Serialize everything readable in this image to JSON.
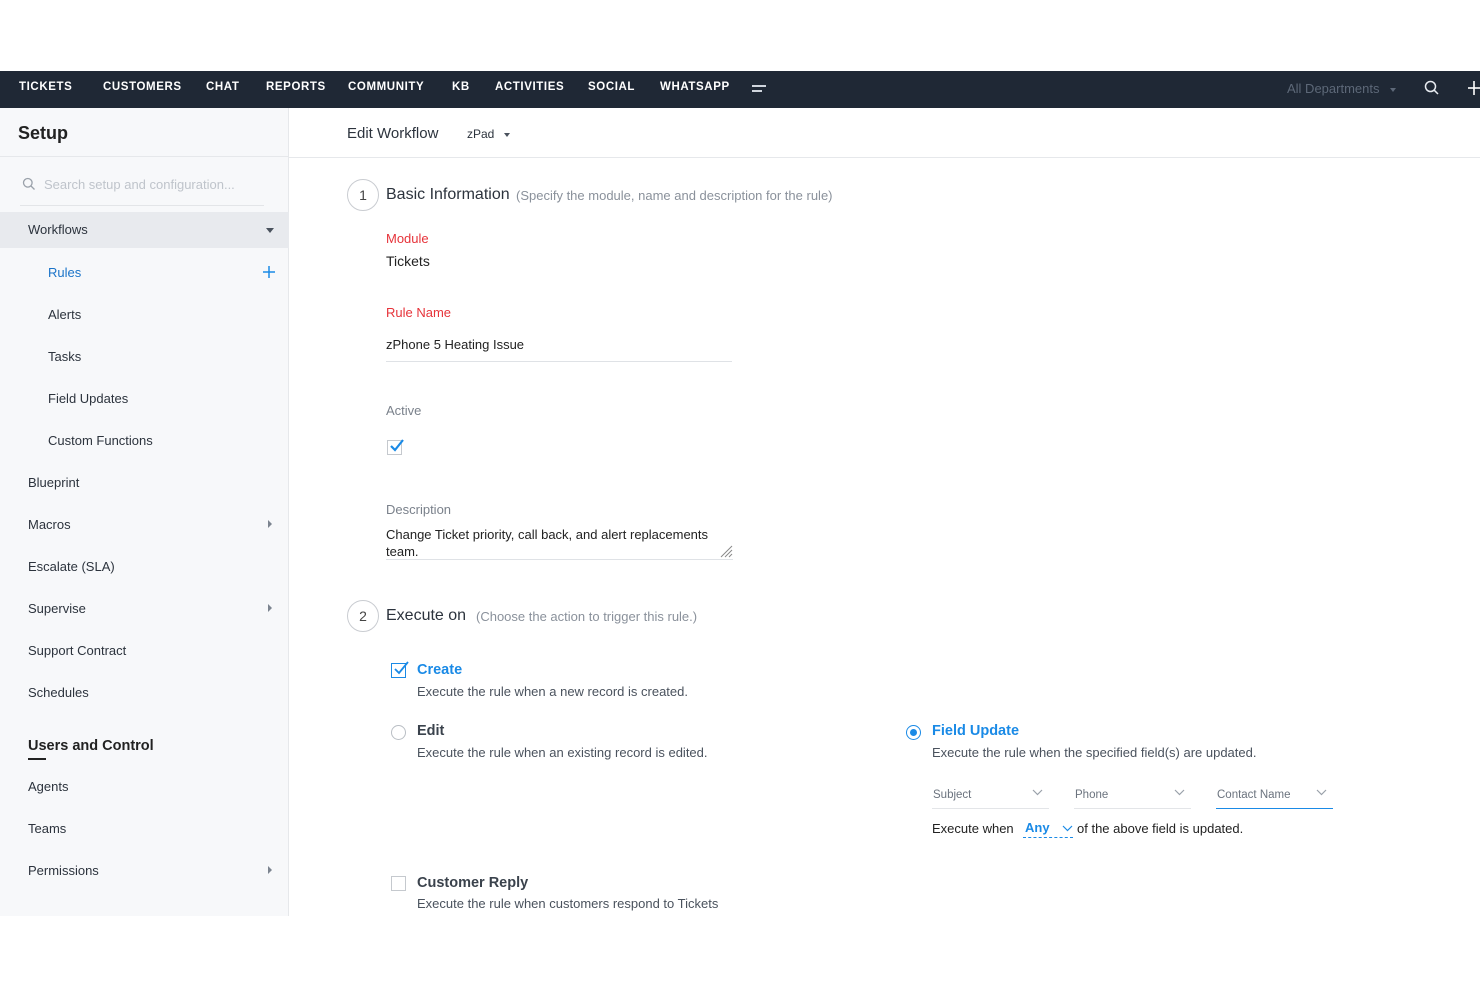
{
  "topnav": {
    "items": [
      "TICKETS",
      "CUSTOMERS",
      "CHAT",
      "REPORTS",
      "COMMUNITY",
      "KB",
      "ACTIVITIES",
      "SOCIAL",
      "WHATSAPP"
    ],
    "department": "All Departments"
  },
  "sidebar": {
    "title": "Setup",
    "search_placeholder": "Search setup and configuration...",
    "items": [
      {
        "label": "Workflows"
      },
      {
        "label": "Rules"
      },
      {
        "label": "Alerts"
      },
      {
        "label": "Tasks"
      },
      {
        "label": "Field Updates"
      },
      {
        "label": "Custom Functions"
      },
      {
        "label": "Blueprint"
      },
      {
        "label": "Macros"
      },
      {
        "label": "Escalate (SLA)"
      },
      {
        "label": "Supervise"
      },
      {
        "label": "Support Contract"
      },
      {
        "label": "Schedules"
      }
    ],
    "section_title": "Users and Control",
    "section_items": [
      {
        "label": "Agents"
      },
      {
        "label": "Teams"
      },
      {
        "label": "Permissions"
      }
    ]
  },
  "header": {
    "title": "Edit Workflow",
    "layout": "zPad"
  },
  "step1": {
    "number": "1",
    "title": "Basic Information",
    "hint": "(Specify the module, name and description for the rule)",
    "module_label": "Module",
    "module_value": "Tickets",
    "rule_name_label": "Rule Name",
    "rule_name_value": "zPhone 5 Heating Issue",
    "active_label": "Active",
    "active_checked": true,
    "description_label": "Description",
    "description_value": "Change Ticket priority, call back, and alert replacements team."
  },
  "step2": {
    "number": "2",
    "title": "Execute on",
    "hint": "(Choose the action to trigger this rule.)",
    "create_title": "Create",
    "create_desc": "Execute the rule when a new record is created.",
    "edit_title": "Edit",
    "edit_desc": "Execute the rule when an existing record is edited.",
    "field_update_title": "Field Update",
    "field_update_desc": "Execute the rule when the specified field(s) are updated.",
    "fields": [
      "Subject",
      "Phone",
      "Contact Name"
    ],
    "execute_when_prefix": "Execute when",
    "execute_when_value": "Any",
    "execute_when_suffix": "of the above field is updated.",
    "customer_reply_title": "Customer Reply",
    "customer_reply_desc": "Execute the rule when customers respond to Tickets"
  },
  "colors": {
    "nav_bg": "#1f2835",
    "accent": "#1a8ae6",
    "required": "#e6333a",
    "sidebar_bg": "#f7f8fa"
  }
}
